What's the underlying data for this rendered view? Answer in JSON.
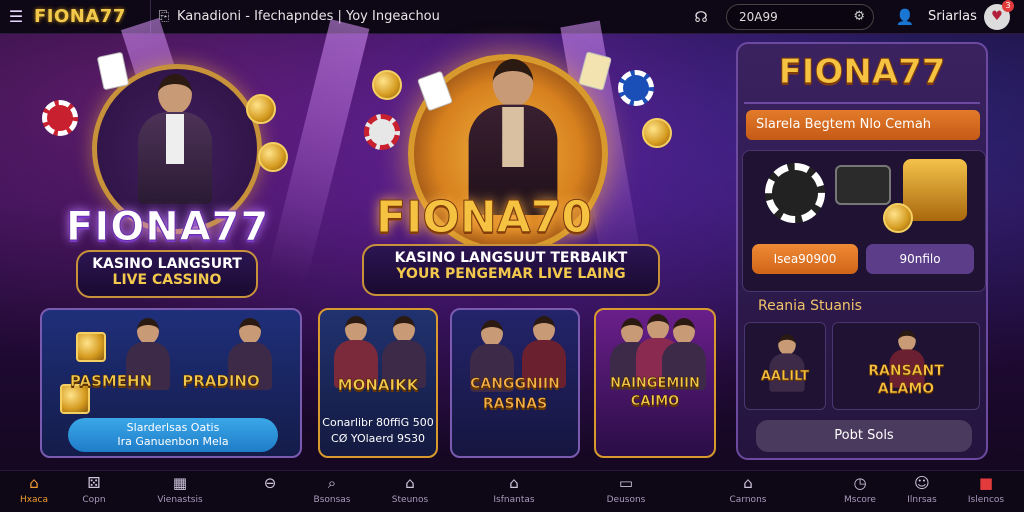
{
  "topbar": {
    "brand": "FIONA77",
    "breadcrumb": "Kanadioni - Ifechapndes  |  Yoy Ingeachou",
    "search_value": "20A99",
    "user_label": "Sriarlas",
    "avatar_badge": "3"
  },
  "hero": {
    "left_logo": "FIONA77",
    "left_line1": "KASINO LANGSURT",
    "left_line2": "LIVE CASSINO",
    "center_logo": "FIONA70",
    "center_line1": "KASINO LANGSUUT TERBAIKT",
    "center_line2": "YOUR PENGEMAR LIVE LAING"
  },
  "game_cards": [
    {
      "title_a": "PASMEHN",
      "title_b": "PRADINO",
      "button_line1": "Slarderlsas Oatis",
      "button_line2": "Ira Ganuenbon Mela"
    },
    {
      "title": "MONAIKK",
      "caption_line1": "Conarlibr 80ffiG 500",
      "caption_line2": "CØ YOlaerd 9S30"
    },
    {
      "title_line1": "CANGGNIIN",
      "title_line2": "RASNAS"
    },
    {
      "title_line1": "NAINGEMIIN",
      "title_line2": "CAIMO"
    }
  ],
  "right_panel": {
    "logo": "FIONA77",
    "orange_bar": "Slarela Begtem Nlo Cemah",
    "btn_left": "Isea90900",
    "btn_right": "90nfilo",
    "section_title": "Reania Stuanis",
    "tile_left": "AALILT",
    "tile_right_line1": "RANSANT",
    "tile_right_line2": "ALAMO",
    "bottom_button": "Pobt Sols"
  },
  "bottom_nav": [
    {
      "label": "Hxaca",
      "icon": "home-icon"
    },
    {
      "label": "Copn",
      "icon": "dice-icon"
    },
    {
      "label": "Vienastsis",
      "icon": "grid-icon"
    },
    {
      "label": "",
      "icon": "minus-circle-icon"
    },
    {
      "label": "Bsonsas",
      "icon": "search-icon"
    },
    {
      "label": "Steunos",
      "icon": "house-outline-icon"
    },
    {
      "label": "Isfnantas",
      "icon": "home-filled-icon"
    },
    {
      "label": "Deusons",
      "icon": "monitor-icon"
    },
    {
      "label": "Carnons",
      "icon": "bank-icon"
    },
    {
      "label": "Mscore",
      "icon": "clock-icon"
    },
    {
      "label": "Ilnrsas",
      "icon": "face-icon"
    },
    {
      "label": "Islencos",
      "icon": "alert-box-icon"
    }
  ],
  "colors": {
    "accent": "#f2c94c",
    "orange": "#e37b2a",
    "panel": "#3a2260",
    "active_nav": "#f29b2f"
  }
}
